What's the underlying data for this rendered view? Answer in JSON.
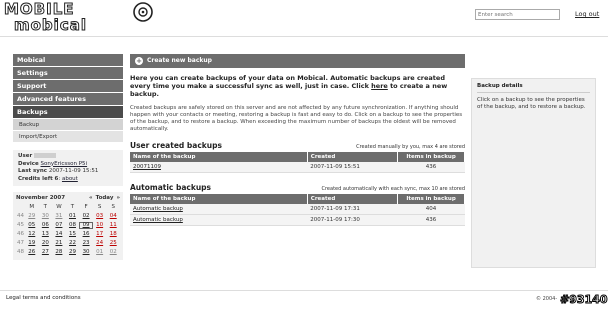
{
  "header": {
    "logo_line1": "MOBILE",
    "logo_line2": "mobical",
    "search_placeholder": "Enter search",
    "logout_label": "Log out"
  },
  "sidebar": {
    "nav": [
      {
        "label": "Mobical"
      },
      {
        "label": "Settings"
      },
      {
        "label": "Support"
      },
      {
        "label": "Advanced features"
      },
      {
        "label": "Backups"
      }
    ],
    "sub": [
      {
        "label": "Backup"
      },
      {
        "label": "Import/Export"
      }
    ],
    "user": {
      "user_label": "User",
      "device_label": "Device",
      "device_value": "SonyEricsson P5i",
      "last_sync_label": "Last sync",
      "last_sync_value": "2007-11-09 15:51",
      "credits_label": "Credits left",
      "credits_value": "6",
      "about_label": "about"
    },
    "calendar": {
      "month": "November 2007",
      "today_label": "Today",
      "prev": "«",
      "next": "»",
      "weekdays": [
        "M",
        "T",
        "W",
        "T",
        "F",
        "S",
        "S"
      ],
      "weeks": [
        {
          "wk": "44",
          "days": [
            "29",
            "30",
            "31",
            "01",
            "02",
            "03",
            "04"
          ]
        },
        {
          "wk": "45",
          "days": [
            "05",
            "06",
            "07",
            "08",
            "09",
            "10",
            "11"
          ]
        },
        {
          "wk": "46",
          "days": [
            "12",
            "13",
            "14",
            "15",
            "16",
            "17",
            "18"
          ]
        },
        {
          "wk": "47",
          "days": [
            "19",
            "20",
            "21",
            "22",
            "23",
            "24",
            "25"
          ]
        },
        {
          "wk": "48",
          "days": [
            "26",
            "27",
            "28",
            "29",
            "30",
            "01",
            "02"
          ]
        }
      ]
    }
  },
  "main": {
    "header_label": "Create new backup",
    "intro": "Here you can create backups of your data on Mobical. Automatic backups are created every time you make a successful sync as well, just in case. Click",
    "intro_link": "here",
    "intro_end": "to create a new backup.",
    "desc": "Created backups are safely stored on this server and are not affected by any future synchronization. If anything should happen with your contacts or meeting, restoring a backup is fast and easy to do. Click on a backup to see the properties of the backup, and to restore a backup. When exceeding the maximum number of backups the oldest will be removed automatically.",
    "user_section": {
      "title": "User created backups",
      "note": "Created manually by you, max 4 are stored",
      "columns": [
        "Name of the backup",
        "Created",
        "Items in backup"
      ],
      "rows": [
        {
          "name": "20071109",
          "created": "2007-11-09 15:51",
          "items": "436"
        }
      ]
    },
    "auto_section": {
      "title": "Automatic backups",
      "note": "Created automatically with each sync, max 10 are stored",
      "columns": [
        "Name of the backup",
        "Created",
        "Items in backup"
      ],
      "rows": [
        {
          "name": "Automatic backup",
          "created": "2007-11-09 17:31",
          "items": "404"
        },
        {
          "name": "Automatic backup",
          "created": "2007-11-09 17:30",
          "items": "436"
        }
      ]
    }
  },
  "right_panel": {
    "title": "Backup details",
    "text": "Click on a backup to see the properties of the backup, and to restore a backup."
  },
  "footer": {
    "legal": "Legal terms and conditions",
    "copyright": "© 2004-",
    "badge": "#93140"
  }
}
